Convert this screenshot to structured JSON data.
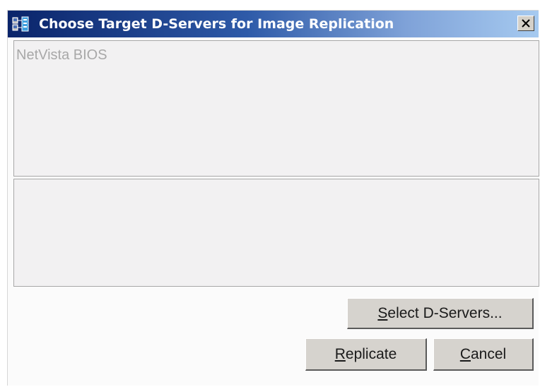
{
  "window": {
    "title": "Choose Target D-Servers for Image Replication"
  },
  "image_list": {
    "items": [
      "NetVista BIOS"
    ]
  },
  "buttons": {
    "select_servers": {
      "mnemonic": "S",
      "rest": "elect D-Servers..."
    },
    "replicate": {
      "mnemonic": "R",
      "rest": "eplicate"
    },
    "cancel": {
      "mnemonic": "C",
      "rest": "ancel"
    }
  },
  "colors": {
    "titlebar_start": "#0a246a",
    "titlebar_end": "#a6caf0",
    "button_face": "#d6d3ce",
    "panel_bg": "#f2f1f2",
    "disabled_text": "#a8a8a8"
  }
}
